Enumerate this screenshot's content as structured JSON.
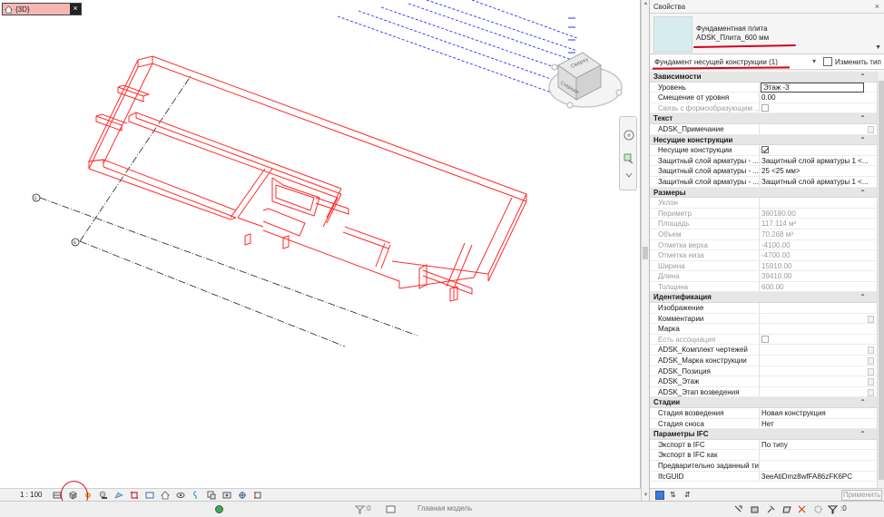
{
  "view_tab": {
    "label": "{3D}",
    "close": "×"
  },
  "view_scale": "1 : 100",
  "view_cube": {
    "face_top": "Сверху",
    "face_front": "Спереди"
  },
  "grid_markers": [
    "Б",
    "В"
  ],
  "properties": {
    "title": "Свойства",
    "close": "×",
    "type_family": "Фундаментная плита",
    "type_name": "ADSK_Плита_600 мм",
    "filter": "Фундамент несущей конструкции (1)",
    "edit_type": "Изменить тип",
    "apply": "Применить",
    "groups": [
      {
        "name": "Зависимости",
        "rows": [
          {
            "k": "Уровень",
            "v": "Этаж -3",
            "boxed": true
          },
          {
            "k": "Смещение от уровня",
            "v": "0.00"
          },
          {
            "k": "Связь с формообразующим ...",
            "chk": false,
            "dis": true
          }
        ]
      },
      {
        "name": "Текст",
        "rows": [
          {
            "k": "ADSK_Примечание",
            "v": "",
            "eb": true
          }
        ]
      },
      {
        "name": "Несущие конструкции",
        "rows": [
          {
            "k": "Несущие конструкции",
            "chk": true
          },
          {
            "k": "Защитный слой арматуры - ...",
            "v": "Защитный слой арматуры 1 <..."
          },
          {
            "k": "Защитный слой арматуры - ...",
            "v": "25 <25 мм>"
          },
          {
            "k": "Защитный слой арматуры - ...",
            "v": "Защитный слой арматуры 1 <..."
          }
        ]
      },
      {
        "name": "Размеры",
        "rows": [
          {
            "k": "Уклон",
            "v": "",
            "dis": true
          },
          {
            "k": "Периметр",
            "v": "360180.00",
            "dis": true
          },
          {
            "k": "Площадь",
            "v": "117.114 м²",
            "dis": true
          },
          {
            "k": "Объем",
            "v": "70.268 м³",
            "dis": true
          },
          {
            "k": "Отметка верха",
            "v": "-4100.00",
            "dis": true
          },
          {
            "k": "Отметка низа",
            "v": "-4700.00",
            "dis": true
          },
          {
            "k": "Ширина",
            "v": "15910.00",
            "dis": true
          },
          {
            "k": "Длина",
            "v": "39410.00",
            "dis": true
          },
          {
            "k": "Толщина",
            "v": "600.00",
            "dis": true
          }
        ]
      },
      {
        "name": "Идентификация",
        "rows": [
          {
            "k": "Изображение",
            "v": ""
          },
          {
            "k": "Комментарии",
            "v": "",
            "eb": true
          },
          {
            "k": "Марка",
            "v": ""
          },
          {
            "k": "Есть ассоциация",
            "chk": false,
            "dis": true
          },
          {
            "k": "ADSK_Комплект чертежей",
            "v": "",
            "eb": true
          },
          {
            "k": "ADSK_Марка конструкции",
            "v": "",
            "eb": true
          },
          {
            "k": "ADSK_Позиция",
            "v": "",
            "eb": true
          },
          {
            "k": "ADSK_Этаж",
            "v": "",
            "eb": true
          },
          {
            "k": "ADSK_Этап возведения",
            "v": "",
            "eb": true
          }
        ]
      },
      {
        "name": "Стадии",
        "rows": [
          {
            "k": "Стадия возведения",
            "v": "Новая конструкция"
          },
          {
            "k": "Стадия сноса",
            "v": "Нет"
          }
        ]
      },
      {
        "name": "Параметры IFC",
        "rows": [
          {
            "k": "Экспорт в IFC",
            "v": "По типу"
          },
          {
            "k": "Экспорт в IFC как",
            "v": ""
          },
          {
            "k": "Предварительно заданный ти...",
            "v": ""
          },
          {
            "k": "IfcGUID",
            "v": "3eeAtiDmz8wfFA86zFK6PC"
          }
        ]
      }
    ]
  },
  "status": {
    "selection_count": ":0",
    "model": "Главная модель"
  },
  "colors": {
    "selection_red": "#ff2a2a",
    "tab_pink": "#f7b6b6",
    "annotation_red": "#d4001c",
    "link_blue": "#2d2dff"
  }
}
